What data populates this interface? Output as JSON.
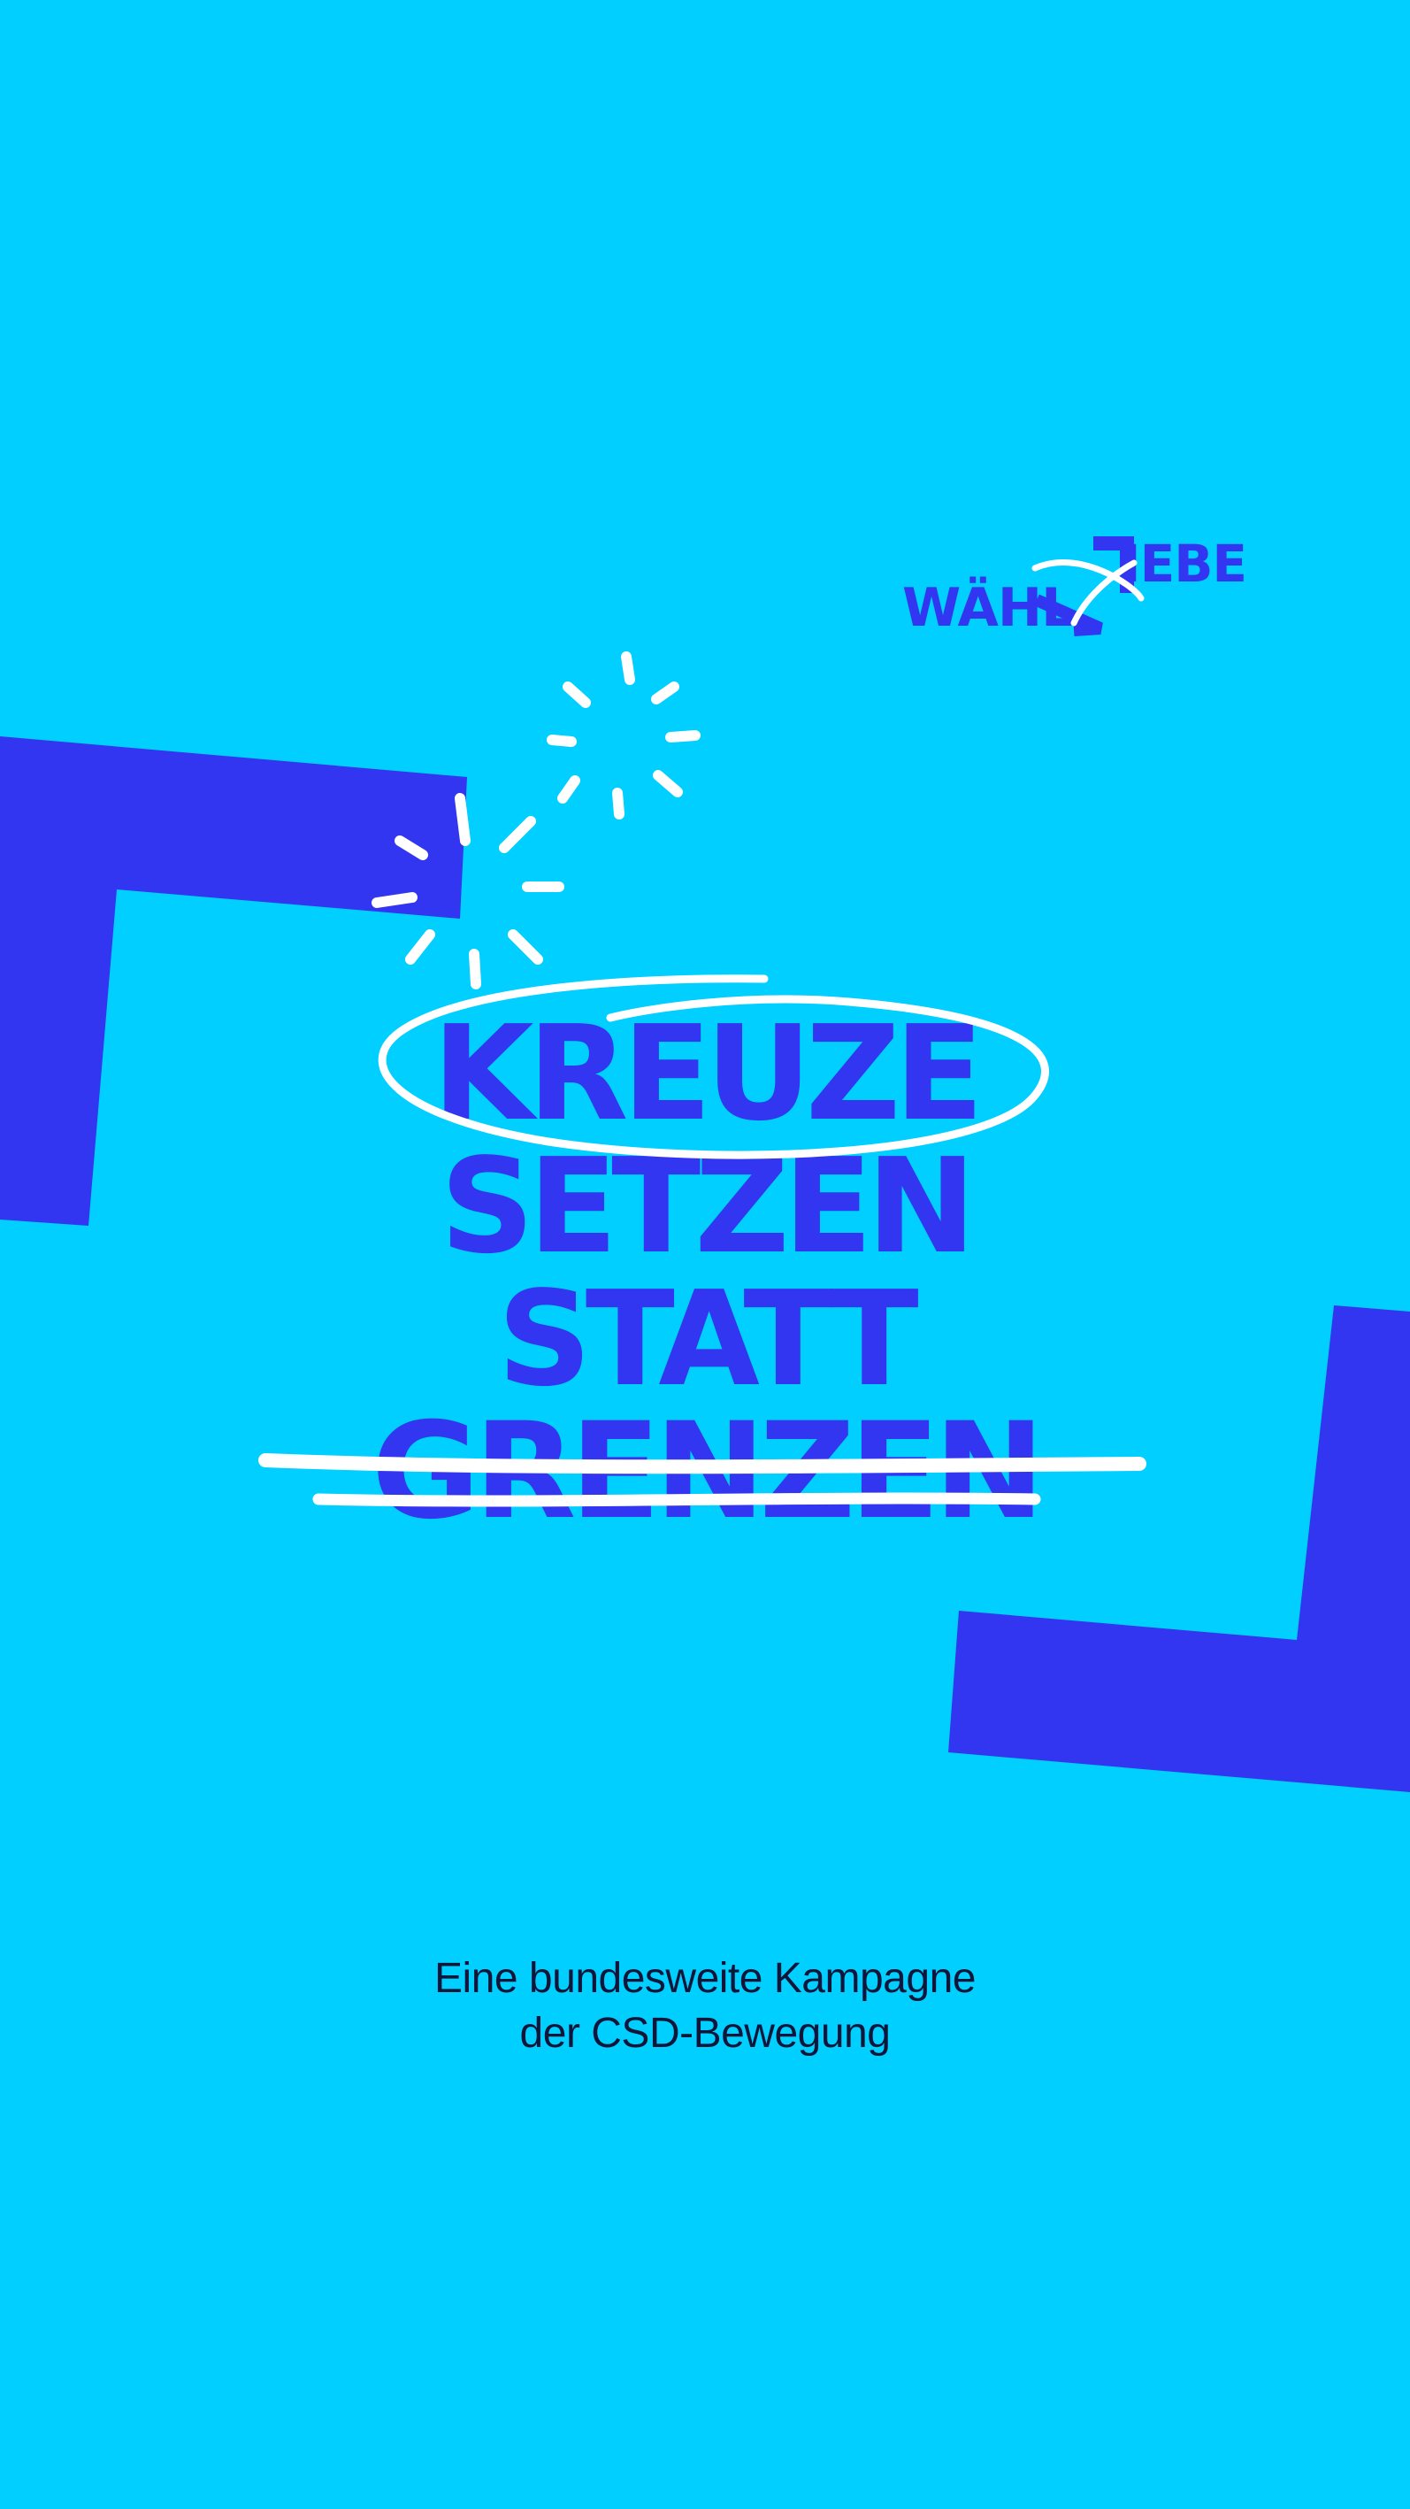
{
  "logo": {
    "word_left": "WÄHL",
    "word_right": "IEBE"
  },
  "headline": {
    "line1": "KREUZE",
    "line2": "SETZEN",
    "line3": "STATT",
    "line4": "GRENZEN"
  },
  "subline": {
    "line1": "Eine bundesweite Kampagne",
    "line2": "der CSD-Bewegung"
  },
  "colors": {
    "background": "#00CFFF",
    "accent": "#3336F0",
    "stroke": "#FFFFFF",
    "text": "#10163A"
  }
}
